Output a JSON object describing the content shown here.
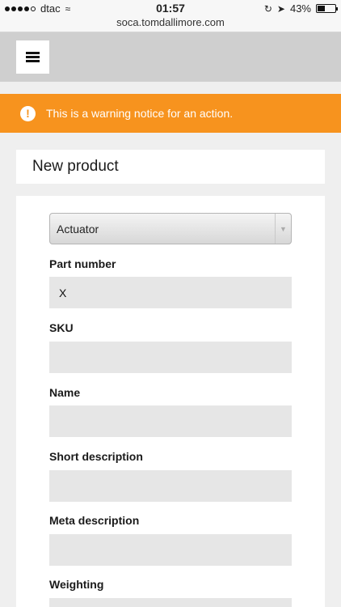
{
  "status_bar": {
    "carrier": "dtac",
    "time": "01:57",
    "url": "soca.tomdallimore.com",
    "battery": "43%",
    "battery_level": 0.43
  },
  "header": {
    "menu_icon": "hamburger-menu-icon"
  },
  "warning": {
    "icon": "exclamation-circle-icon",
    "message": "This is a warning notice for an action.",
    "color": "#f7931e"
  },
  "page": {
    "title": "New product"
  },
  "form": {
    "product_type": {
      "selected": "Actuator"
    },
    "fields": [
      {
        "label": "Part number",
        "value": "X"
      },
      {
        "label": "SKU",
        "value": ""
      },
      {
        "label": "Name",
        "value": ""
      },
      {
        "label": "Short description",
        "value": ""
      },
      {
        "label": "Meta description",
        "value": ""
      },
      {
        "label": "Weighting",
        "value": ""
      }
    ]
  }
}
